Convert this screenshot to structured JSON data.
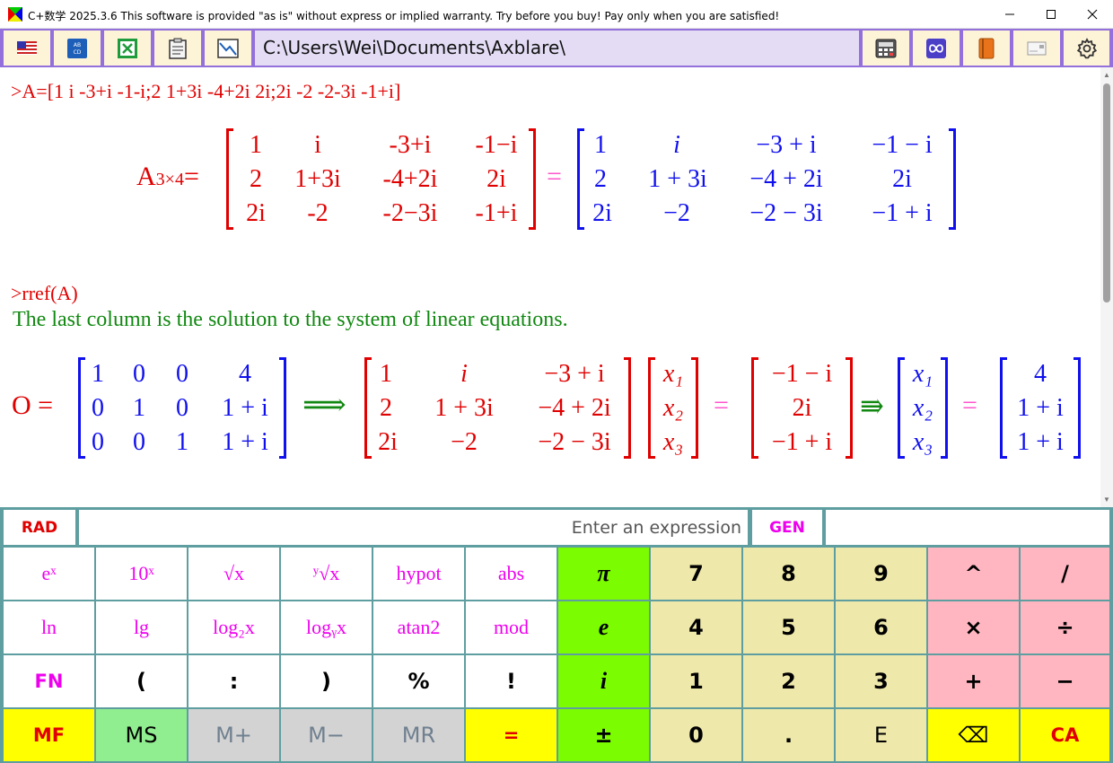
{
  "titlebar": {
    "title": "C+数学 2025.3.6 This software is provided \"as is\" without express or implied warranty. Try before you buy! Pay only when you are satisfied!",
    "minimize_icon": "minimize-icon",
    "maximize_icon": "maximize-icon",
    "close_icon": "close-icon"
  },
  "toolbar": {
    "left_buttons": [
      "us-flag-icon",
      "abcd-icon",
      "excel-icon",
      "clipboard-icon",
      "chart-icon"
    ],
    "path": "C:\\Users\\Wei\\Documents\\Axblare\\",
    "right_buttons": [
      "calculator-icon",
      "infinity-icon",
      "book-icon",
      "card-icon",
      "gear-icon"
    ]
  },
  "output": {
    "cmd1": ">A=[1 i -3+i -1-i;2 1+3i -4+2i 2i;2i -2 -2-3i -1+i]",
    "lhs_name": "A",
    "lhs_sub": "3×4",
    "eq": "=",
    "matrix_plain": [
      [
        "1",
        "i",
        "-3+i",
        "-1−i"
      ],
      [
        "2",
        "1+3i",
        "-4+2i",
        "2i"
      ],
      [
        "2i",
        "-2",
        "-2−3i",
        "-1+i"
      ]
    ],
    "matrix_math": [
      [
        "1",
        "i",
        "−3 + i",
        "−1 − i"
      ],
      [
        "2",
        "1 + 3i",
        "−4 + 2i",
        "2i"
      ],
      [
        "2i",
        "−2",
        "−2 − 3i",
        "−1 + i"
      ]
    ],
    "cmd2": ">rref(A)",
    "note": "The last column is the solution to the system of linear equations.",
    "res_lhs": "O =",
    "rref": [
      [
        "1",
        "0",
        "0",
        "4"
      ],
      [
        "0",
        "1",
        "0",
        "1 + i"
      ],
      [
        "0",
        "0",
        "1",
        "1 + i"
      ]
    ],
    "implies": "⟹",
    "coef": [
      [
        "1",
        "i",
        "−3 + i"
      ],
      [
        "2",
        "1 + 3i",
        "−4 + 2i"
      ],
      [
        "2i",
        "−2",
        "−2 − 3i"
      ]
    ],
    "xvec": [
      "x₁",
      "x₂",
      "x₃"
    ],
    "rhs": [
      "−1 − i",
      "2i",
      "−1 + i"
    ],
    "implies2": "⇛",
    "xvec2": [
      "x₁",
      "x₂",
      "x₃"
    ],
    "sol": [
      "4",
      "1 + i",
      "1 + i"
    ]
  },
  "inputrow": {
    "mode": "RAD",
    "placeholder": "Enter an expression",
    "gen": "GEN"
  },
  "keypad": {
    "row1": [
      "eˣ",
      "10ˣ",
      "√x",
      "ʸ√x",
      "hypot",
      "abs",
      "π",
      "7",
      "8",
      "9",
      "^",
      "/"
    ],
    "row2": [
      "ln",
      "lg",
      "log₂x",
      "logᵧx",
      "atan2",
      "mod",
      "e",
      "4",
      "5",
      "6",
      "×",
      "÷"
    ],
    "row3": [
      "FN",
      "(",
      ":",
      ")",
      "%",
      "!",
      "i",
      "1",
      "2",
      "3",
      "+",
      "−"
    ],
    "row4": [
      "MF",
      "MS",
      "M+",
      "M−",
      "MR",
      "=",
      "±",
      "0",
      ".",
      "E",
      "⌫",
      "CA"
    ]
  },
  "colors": {
    "toolbar": "#9370db",
    "keypad_bg": "#5f9ea0",
    "expr_red": "#e00000",
    "expr_blue": "#1010ee",
    "note_green": "#118811"
  }
}
